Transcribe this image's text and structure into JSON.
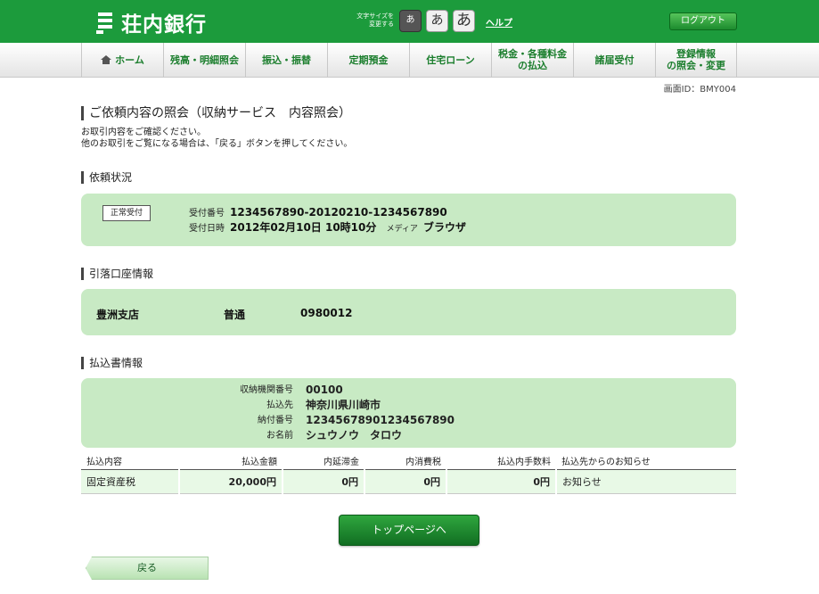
{
  "header": {
    "bank_name": "荘内銀行",
    "font_size_label_1": "文字サイズを",
    "font_size_label_2": "変更する",
    "font_small": "あ",
    "font_medium": "あ",
    "font_large": "あ",
    "help": "ヘルプ",
    "logout": "ログアウト"
  },
  "nav": {
    "items": [
      {
        "label": "ホーム",
        "icon": "home-icon"
      },
      {
        "label": "残高・明細照会"
      },
      {
        "label": "振込・振替"
      },
      {
        "label": "定期預金"
      },
      {
        "label": "住宅ローン"
      },
      {
        "label_line1": "税金・各種料金",
        "label_line2": "の払込"
      },
      {
        "label": "諸届受付"
      },
      {
        "label_line1": "登録情報",
        "label_line2": "の照会・変更"
      }
    ]
  },
  "screen_id": "画面ID：BMY004",
  "page": {
    "title": "ご依頼内容の照会（収納サービス　内容照会）",
    "instruction_1": "お取引内容をご確認ください。",
    "instruction_2": "他のお取引をご覧になる場合は、「戻る」ボタンを押してください。"
  },
  "request_status": {
    "heading": "依頼状況",
    "badge": "正常受付",
    "receipt_no_label": "受付番号",
    "receipt_no": "1234567890-20120210-1234567890",
    "receipt_date_label": "受付日時",
    "receipt_date": "2012年02月10日 10時10分",
    "media_label": "メディア",
    "media": "ブラウザ"
  },
  "account": {
    "heading": "引落口座情報",
    "branch": "豊洲支店",
    "type": "普通",
    "number": "0980012"
  },
  "payment": {
    "heading": "払込書情報",
    "institution_no_label": "収納機関番号",
    "institution_no": "00100",
    "payee_label": "払込先",
    "payee": "神奈川県川崎市",
    "payment_no_label": "納付番号",
    "payment_no": "12345678901234567890",
    "name_label": "お名前",
    "name": "シュウノウ　タロウ"
  },
  "table": {
    "headers": [
      "払込内容",
      "払込金額",
      "内延滞金",
      "内消費税",
      "払込内手数料",
      "払込先からのお知らせ"
    ],
    "row": [
      "固定資産税",
      "20,000円",
      "0円",
      "0円",
      "0円",
      "お知らせ"
    ]
  },
  "buttons": {
    "top_page": "トップページへ",
    "back": "戻る"
  },
  "colors": {
    "brand_green": "#1c9b3c",
    "panel_green": "#c8eac4",
    "row_green": "#e8f9e6"
  }
}
